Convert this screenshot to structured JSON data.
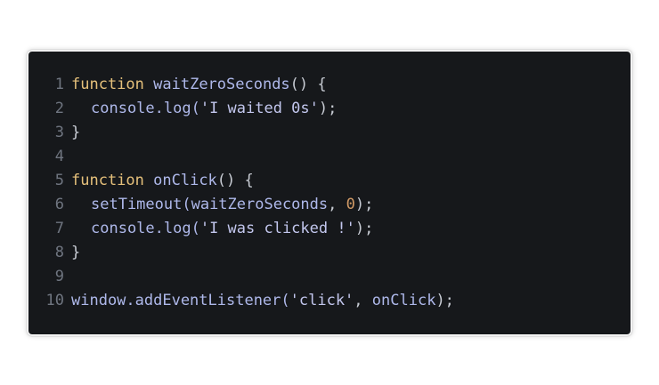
{
  "colors": {
    "background": "#ffffff",
    "editor_background": "#16181b",
    "line_number": "#6f7580",
    "keyword": "#e5c07b",
    "identifier": "#aeb8ea",
    "punctuation": "#c8ccd4",
    "number": "#d19a66"
  },
  "code": {
    "language": "javascript",
    "lines": [
      {
        "num": "1",
        "text": "function waitZeroSeconds() {"
      },
      {
        "num": "2",
        "text": "  console.log('I waited 0s');"
      },
      {
        "num": "3",
        "text": "}"
      },
      {
        "num": "4",
        "text": ""
      },
      {
        "num": "5",
        "text": "function onClick() {"
      },
      {
        "num": "6",
        "text": "  setTimeout(waitZeroSeconds, 0);"
      },
      {
        "num": "7",
        "text": "  console.log('I was clicked !');"
      },
      {
        "num": "8",
        "text": "}"
      },
      {
        "num": "9",
        "text": ""
      },
      {
        "num": "10",
        "text": "window.addEventListener('click', onClick);"
      }
    ]
  },
  "tokens": {
    "kw_function": "function",
    "waitZeroSeconds": "waitZeroSeconds",
    "paren_open_close_brace": "() {",
    "console_log": "console.log(",
    "str_waited": "'I waited 0s'",
    "paren_semicolon": ");",
    "brace_close": "}",
    "onClick": "onClick",
    "setTimeout": "setTimeout(",
    "comma_space": ", ",
    "zero": "0",
    "str_clicked": "'I was clicked !'",
    "window_add": "window.addEventListener(",
    "str_click": "'click'"
  }
}
